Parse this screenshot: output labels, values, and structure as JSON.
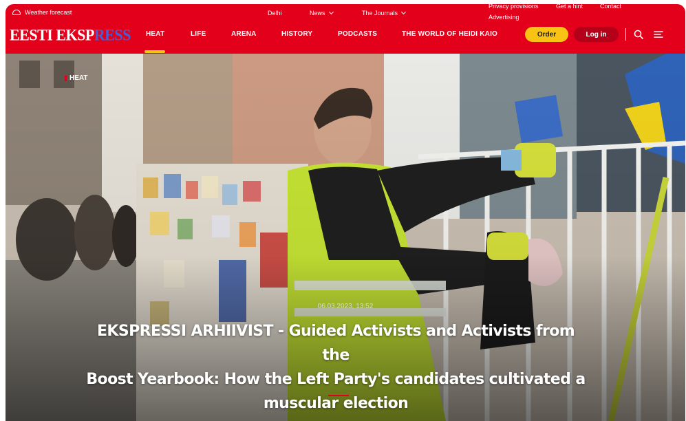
{
  "utility": {
    "weather": "Weather forecast",
    "city": "Delhi",
    "news": "News",
    "journals": "The Journals",
    "privacy": "Privacy provisions",
    "hint": "Get a hint",
    "contact": "Contact",
    "advertising": "Advertising"
  },
  "brand": {
    "logo_main": "EESTI EKSP",
    "logo_accent": "RESS"
  },
  "nav": {
    "items": [
      "HEAT",
      "LIFE",
      "ARENA",
      "HISTORY",
      "PODCASTS",
      "THE WORLD OF HEIDI KAIO"
    ],
    "active": "HEAT",
    "order_label": "Order",
    "login_label": "Log in"
  },
  "article": {
    "tag": "HEAT",
    "date": "06.03.2023, 13:52",
    "headline_lines": [
      "EKSPRESSI ARHIIVIST - Guided Activists and Activists from the",
      "Boost Yearbook: How the Left Party's candidates cultivated a",
      "muscular election"
    ]
  },
  "colors": {
    "brand_red": "#e3001b",
    "order_yellow": "#f8c315",
    "login_dark_red": "#b5001a",
    "active_underline": "#f6c712"
  },
  "icons": [
    "cloud-icon",
    "chevron-down-icon",
    "search-icon",
    "menu-icon"
  ]
}
